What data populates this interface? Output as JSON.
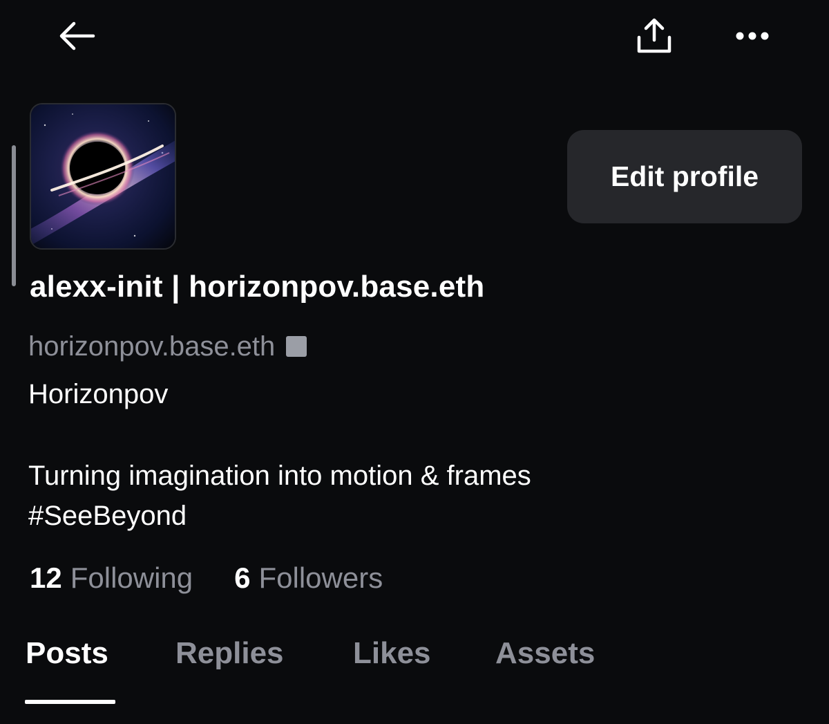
{
  "header": {
    "back_icon": "arrow-left-icon",
    "share_icon": "share-upload-icon",
    "more_icon": "more-horizontal-icon"
  },
  "profile": {
    "avatar_icon": "black-hole-image",
    "edit_button_label": "Edit profile",
    "display_name": "alexx-init | horizonpov.base.eth",
    "handle": "horizonpov.base.eth",
    "bio_lines": [
      "Horizonpov",
      "Turning imagination into motion & frames",
      "#SeeBeyond"
    ],
    "following_count": "12",
    "following_label": "Following",
    "followers_count": "6",
    "followers_label": "Followers"
  },
  "tabs": [
    {
      "label": "Posts",
      "active": true
    },
    {
      "label": "Replies",
      "active": false
    },
    {
      "label": "Likes",
      "active": false
    },
    {
      "label": "Assets",
      "active": false
    }
  ],
  "colors": {
    "background": "#0a0b0d",
    "muted_text": "#8e9099",
    "button_bg": "#26272b",
    "text": "#ffffff"
  }
}
